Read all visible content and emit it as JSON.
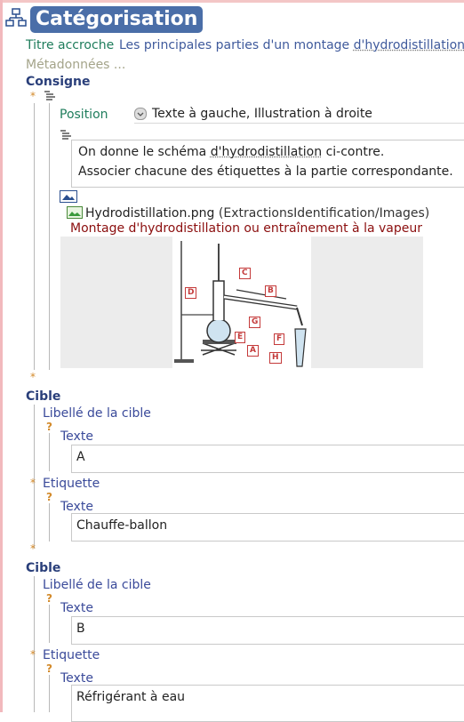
{
  "header": {
    "title": "Catégorisation"
  },
  "titre_accroche": {
    "label": "Titre accroche",
    "value_prefix": "Les principales parties d'un montage ",
    "value_link": "d'hydrodistillation"
  },
  "metadonnees": {
    "label": "Métadonnées ..."
  },
  "consigne": {
    "label": "Consigne",
    "position_label": "Position",
    "position_value": "Texte à gauche, Illustration à droite",
    "text_line1_prefix": "On donne le schéma ",
    "text_line1_link": "d'hydrodistillation",
    "text_line1_suffix": " ci-contre.",
    "text_line2": "Associer chacune des étiquettes à la partie correspondante.",
    "image_filename": "Hydrodistillation.png",
    "image_path": "(ExtractionsIdentification/Images)",
    "image_caption": "Montage d'hydrodistillation ou entraînement à la vapeur",
    "diagram_labels": [
      "C",
      "D",
      "B",
      "G",
      "E",
      "F",
      "A",
      "H"
    ]
  },
  "cibles": [
    {
      "label": "Cible",
      "libelle_label": "Libellé de la cible",
      "texte_label": "Texte",
      "libelle_value": "A",
      "etiquette_label": "Etiquette",
      "etiquette_texte_label": "Texte",
      "etiquette_value": "Chauffe-ballon"
    },
    {
      "label": "Cible",
      "libelle_label": "Libellé de la cible",
      "texte_label": "Texte",
      "libelle_value": "B",
      "etiquette_label": "Etiquette",
      "etiquette_texte_label": "Texte",
      "etiquette_value": "Réfrigérant à eau"
    }
  ],
  "symbols": {
    "required": "*",
    "optional": "?"
  }
}
